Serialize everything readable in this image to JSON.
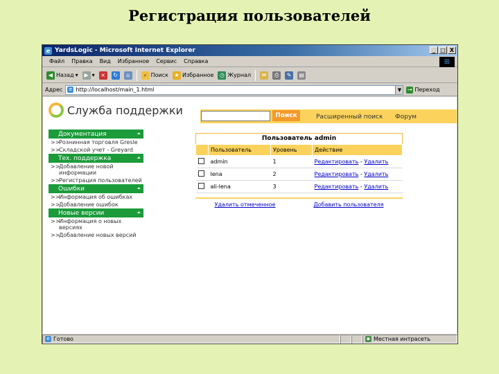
{
  "slide": {
    "title": "Регистрация пользователей"
  },
  "window": {
    "title": "YardsLogic - Microsoft Internet Explorer",
    "controls": [
      "_",
      "□",
      "X"
    ]
  },
  "menu": [
    "Файл",
    "Правка",
    "Вид",
    "Избранное",
    "Сервис",
    "Справка"
  ],
  "toolbar": {
    "back": "Назад",
    "search": "Поиск",
    "favorites": "Избранное",
    "history": "Журнал"
  },
  "address": {
    "label": "Адрес",
    "url": "http://localhost/main_1.html",
    "go": "Переход"
  },
  "site": {
    "brand": "Служба поддержки",
    "search_button": "Поиск",
    "advanced_search": "Расширенный поиск",
    "forum": "Форум"
  },
  "sidebar": {
    "sections": [
      {
        "title": "Документация",
        "items": [
          "Рознинная торговля Gresle",
          "Складской учет - Greyard"
        ]
      },
      {
        "title": "Тех. поддержка",
        "items": [
          "Добавление новой информации",
          "Регистрация пользователей"
        ]
      },
      {
        "title": "Ошибки",
        "items": [
          "Информация об ошибках",
          "Добавление ошибок"
        ]
      },
      {
        "title": "Новые версии",
        "items": [
          "Информация о новых версиях",
          "Добавление новых версий"
        ]
      }
    ]
  },
  "panel": {
    "title": "Пользователь admin",
    "columns": [
      "Пользователь",
      "Уровень",
      "Действие"
    ],
    "rows": [
      {
        "user": "admin",
        "level": "1",
        "edit": "Редактировать",
        "sep": " - ",
        "delete": "Удалить"
      },
      {
        "user": "lena",
        "level": "2",
        "edit": "Редактировать",
        "sep": " - ",
        "delete": "Удалить"
      },
      {
        "user": "ali-lena",
        "level": "3",
        "edit": "Редактировать",
        "sep": " - ",
        "delete": "Удалить"
      }
    ],
    "delete_selected": "Удалить отмеченное",
    "add_user": "Добавить пользователя"
  },
  "status": {
    "text": "Готово",
    "zone": "Местная интрасеть"
  }
}
